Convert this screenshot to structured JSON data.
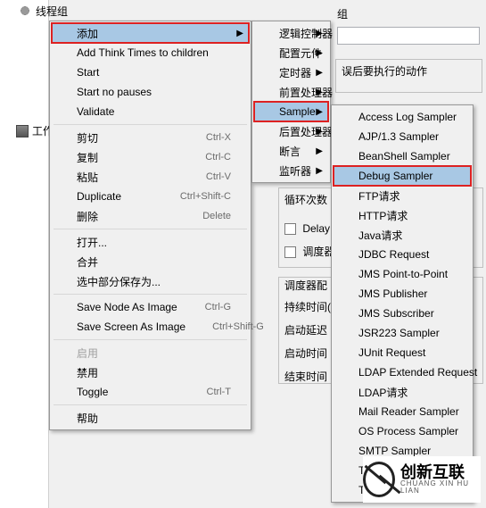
{
  "bg": {
    "header_fragment": "组",
    "err_action_label": "误后要执行的动作",
    "loop_label": "循环次数",
    "delay_checkbox": "Delay T",
    "scheduler_checkbox": "调度器",
    "scheduler_group": "调度器配",
    "duration_label": "持续时间(",
    "startup_delay_label": "启动延迟",
    "start_time_label": "启动时间",
    "end_time_label": "结束时间",
    "tree_root": "线程组",
    "workbench": "工作台",
    "toolbar_partial": "线程组"
  },
  "menu1": {
    "items": [
      {
        "label": "添加",
        "submenu": true,
        "hl": true,
        "box": true
      },
      {
        "label": "Add Think Times to children"
      },
      {
        "label": "Start"
      },
      {
        "label": "Start no pauses"
      },
      {
        "label": "Validate"
      },
      {
        "sep": true
      },
      {
        "label": "剪切",
        "shortcut": "Ctrl-X"
      },
      {
        "label": "复制",
        "shortcut": "Ctrl-C"
      },
      {
        "label": "粘贴",
        "shortcut": "Ctrl-V"
      },
      {
        "label": "Duplicate",
        "shortcut": "Ctrl+Shift-C"
      },
      {
        "label": "删除",
        "shortcut": "Delete"
      },
      {
        "sep": true
      },
      {
        "label": "打开..."
      },
      {
        "label": "合并"
      },
      {
        "label": "选中部分保存为..."
      },
      {
        "sep": true
      },
      {
        "label": "Save Node As Image",
        "shortcut": "Ctrl-G"
      },
      {
        "label": "Save Screen As Image",
        "shortcut": "Ctrl+Shift-G"
      },
      {
        "sep": true
      },
      {
        "label": "启用",
        "disabled": true
      },
      {
        "label": "禁用"
      },
      {
        "label": "Toggle",
        "shortcut": "Ctrl-T"
      },
      {
        "sep": true
      },
      {
        "label": "帮助"
      }
    ]
  },
  "menu2": {
    "items": [
      {
        "label": "逻辑控制器",
        "submenu": true
      },
      {
        "label": "配置元件",
        "submenu": true
      },
      {
        "label": "定时器",
        "submenu": true
      },
      {
        "label": "前置处理器",
        "submenu": true
      },
      {
        "label": "Sampler",
        "submenu": true,
        "hl": true,
        "box": true
      },
      {
        "label": "后置处理器",
        "submenu": true
      },
      {
        "label": "断言",
        "submenu": true
      },
      {
        "label": "监听器",
        "submenu": true
      }
    ]
  },
  "menu3": {
    "items": [
      {
        "label": "Access Log Sampler"
      },
      {
        "label": "AJP/1.3 Sampler"
      },
      {
        "label": "BeanShell Sampler"
      },
      {
        "label": "Debug Sampler",
        "hl": true,
        "box": true
      },
      {
        "label": "FTP请求"
      },
      {
        "label": "HTTP请求"
      },
      {
        "label": "Java请求"
      },
      {
        "label": "JDBC Request"
      },
      {
        "label": "JMS Point-to-Point"
      },
      {
        "label": "JMS Publisher"
      },
      {
        "label": "JMS Subscriber"
      },
      {
        "label": "JSR223 Sampler"
      },
      {
        "label": "JUnit Request"
      },
      {
        "label": "LDAP Extended Request"
      },
      {
        "label": "LDAP请求"
      },
      {
        "label": "Mail Reader Sampler"
      },
      {
        "label": "OS Process Sampler"
      },
      {
        "label": "SMTP Sampler"
      },
      {
        "label": "TCI"
      },
      {
        "label": "Tes"
      }
    ]
  },
  "logo": {
    "big": "创新互联",
    "small": "CHUANG XIN HU LIAN"
  }
}
